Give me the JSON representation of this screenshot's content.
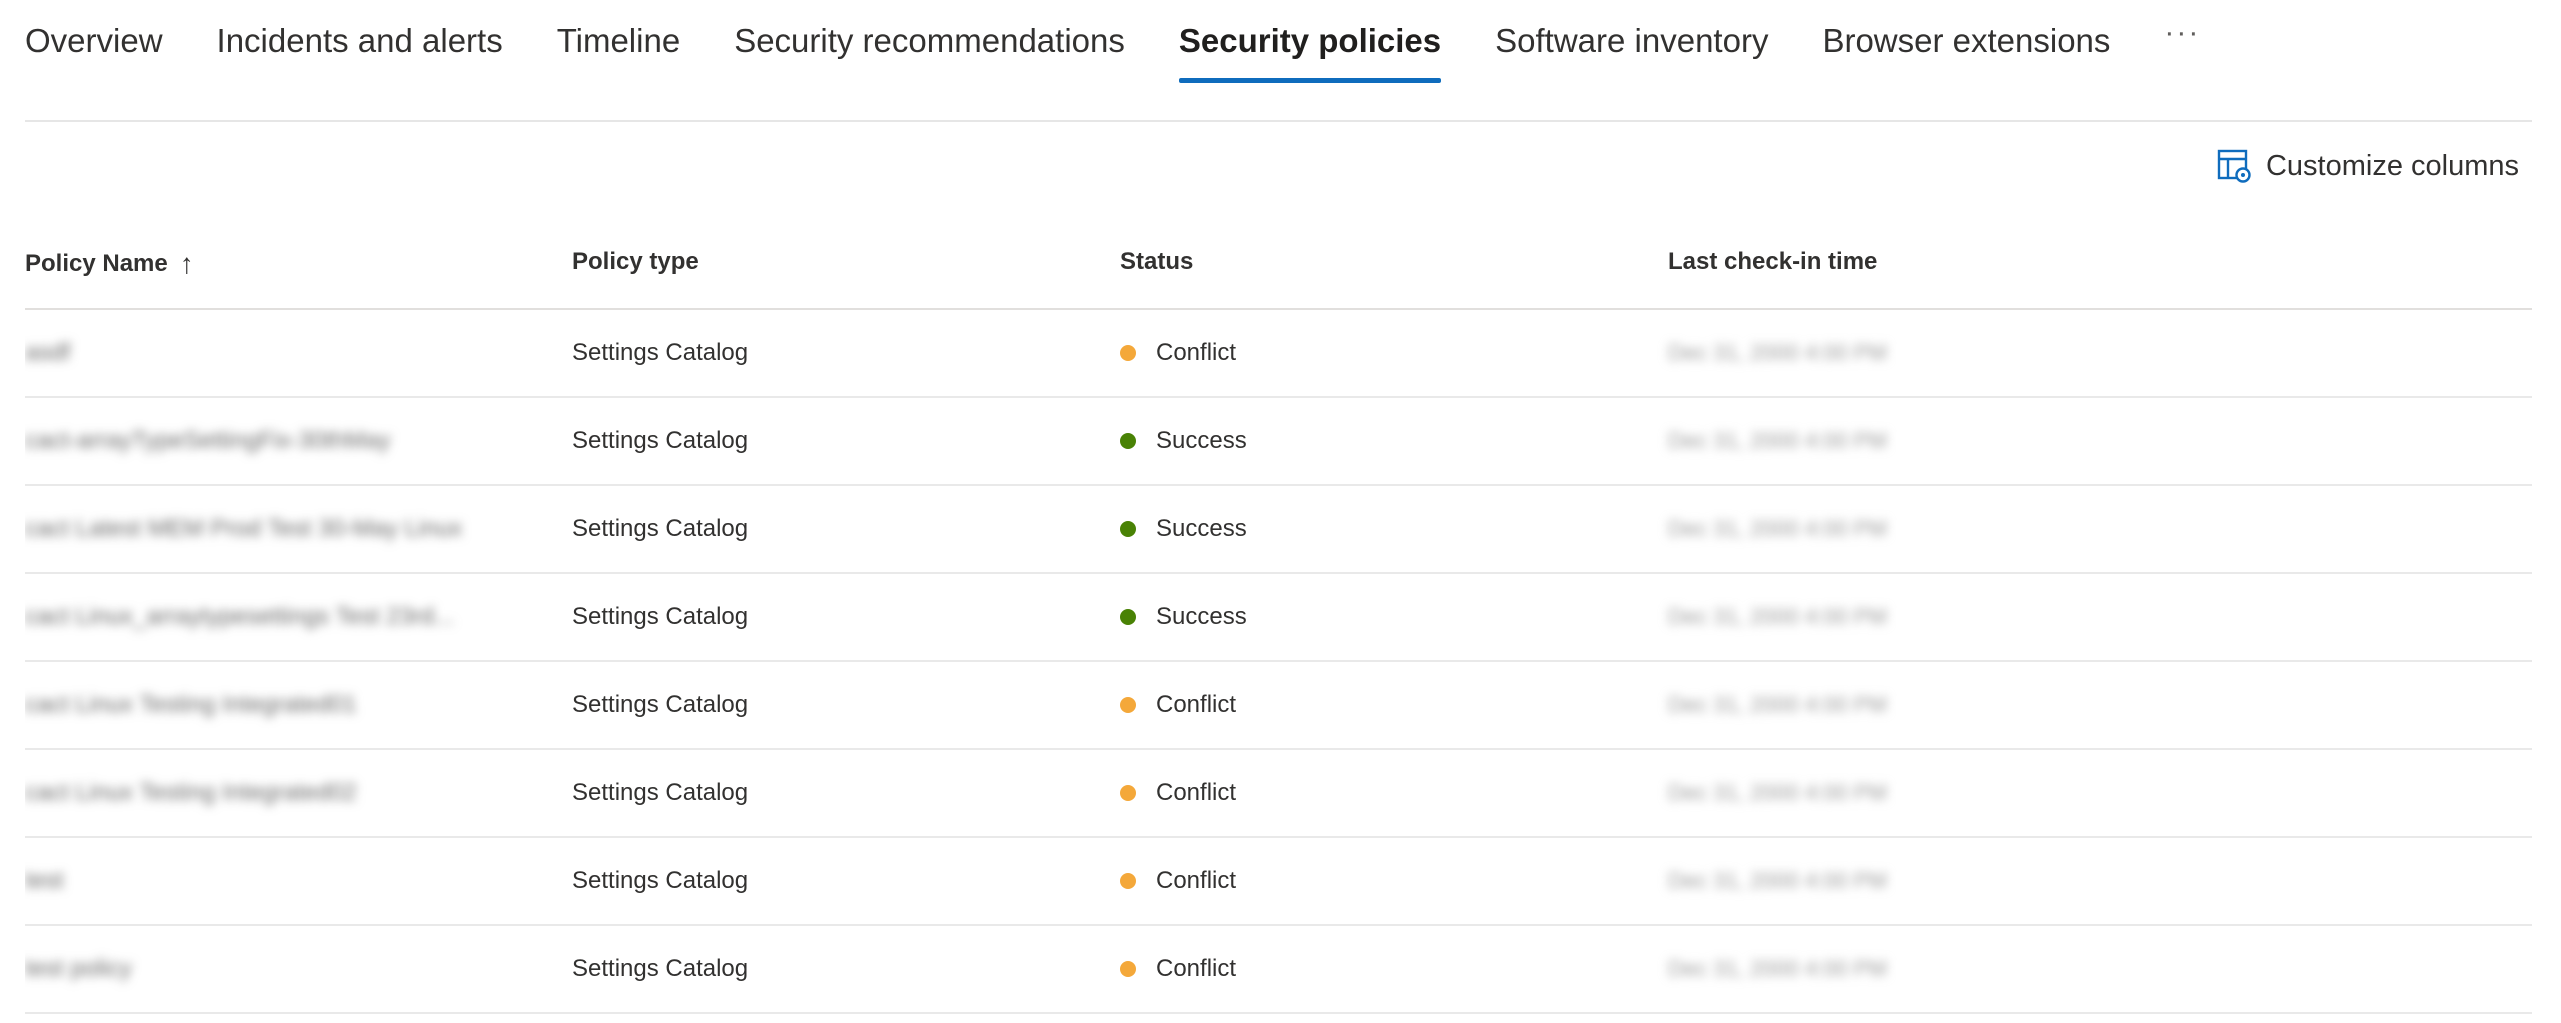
{
  "tabs": [
    {
      "label": "Overview",
      "active": false
    },
    {
      "label": "Incidents and alerts",
      "active": false
    },
    {
      "label": "Timeline",
      "active": false
    },
    {
      "label": "Security recommendations",
      "active": false
    },
    {
      "label": "Security policies",
      "active": true
    },
    {
      "label": "Software inventory",
      "active": false
    },
    {
      "label": "Browser extensions",
      "active": false
    }
  ],
  "tabs_more_label": "···",
  "toolbar": {
    "customize_label": "Customize columns",
    "customize_icon": "customize-columns-icon"
  },
  "table": {
    "columns": {
      "name": "Policy Name",
      "type": "Policy type",
      "status": "Status",
      "time": "Last check-in time"
    },
    "sort_icon": "arrow-up-icon",
    "status_colors": {
      "Conflict": "#f4a83a",
      "Success": "#498205"
    },
    "rows": [
      {
        "name": "asdf",
        "type": "Settings Catalog",
        "status": "Conflict",
        "time": "Dec 31, 2000 4:00 PM"
      },
      {
        "name": "cact-arrayTypeSettingFix-30thMay",
        "type": "Settings Catalog",
        "status": "Success",
        "time": "Dec 31, 2000 4:00 PM"
      },
      {
        "name": "cact Latest MEM Prod Test 30-May Linux",
        "type": "Settings Catalog",
        "status": "Success",
        "time": "Dec 31, 2000 4:00 PM"
      },
      {
        "name": "cact Linux_arraytypesettings Test 23rd...",
        "type": "Settings Catalog",
        "status": "Success",
        "time": "Dec 31, 2000 4:00 PM"
      },
      {
        "name": "cact Linux Testing Integrated01",
        "type": "Settings Catalog",
        "status": "Conflict",
        "time": "Dec 31, 2000 4:00 PM"
      },
      {
        "name": "cact Linux Testing Integrated02",
        "type": "Settings Catalog",
        "status": "Conflict",
        "time": "Dec 31, 2000 4:00 PM"
      },
      {
        "name": "test",
        "type": "Settings Catalog",
        "status": "Conflict",
        "time": "Dec 31, 2000 4:00 PM"
      },
      {
        "name": "test policy",
        "type": "Settings Catalog",
        "status": "Conflict",
        "time": "Dec 31, 2000 4:00 PM"
      }
    ]
  }
}
